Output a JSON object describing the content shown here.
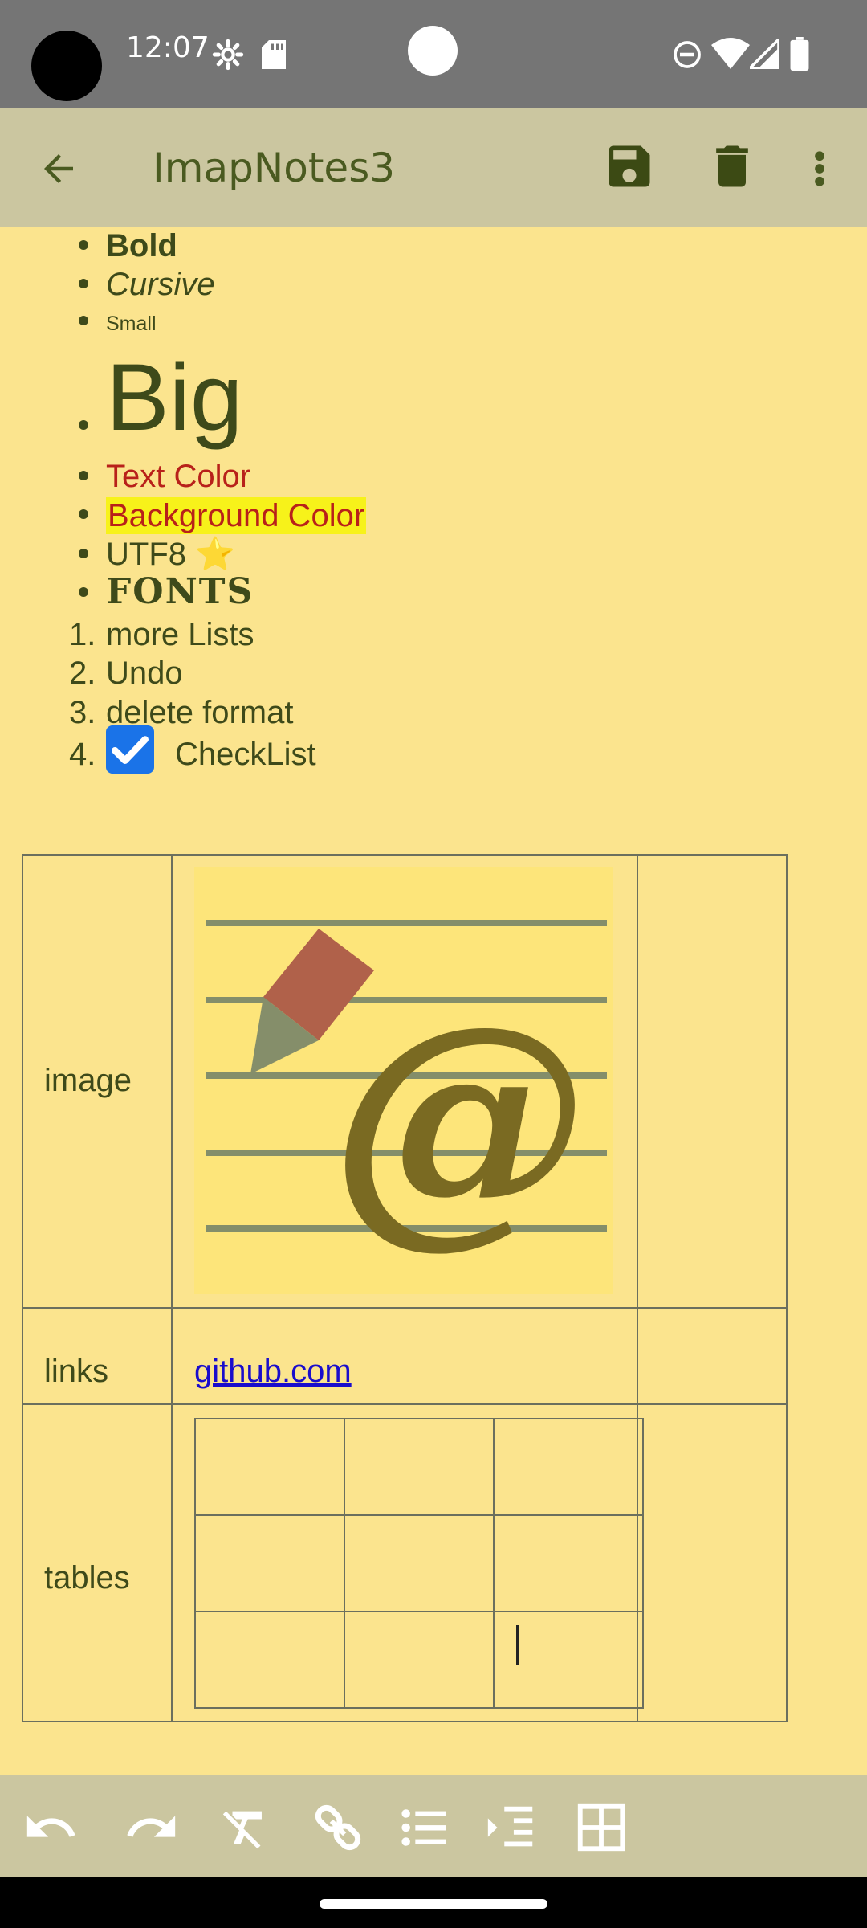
{
  "status_bar": {
    "time": "12:07",
    "icons": [
      "settings-icon",
      "sd-card-icon",
      "dnd-icon",
      "wifi-icon",
      "signal-icon",
      "battery-icon"
    ]
  },
  "app_bar": {
    "title": "ImapNotes3",
    "back": "back-arrow-icon",
    "save": "save-icon",
    "delete": "delete-icon",
    "more": "more-vert-icon"
  },
  "note": {
    "bullets": [
      {
        "label": "Bold"
      },
      {
        "label": "Cursive"
      },
      {
        "label": "Small"
      },
      {
        "label": "Big"
      },
      {
        "label": "Text Color"
      },
      {
        "label": "Background Color"
      },
      {
        "label": "UTF8 ⭐"
      },
      {
        "label": "FONTS"
      }
    ],
    "numbered": [
      {
        "num": "1.",
        "label": "more Lists"
      },
      {
        "num": "2.",
        "label": "Undo"
      },
      {
        "num": "3.",
        "label": "delete format"
      },
      {
        "num": "4.",
        "label": "CheckList"
      }
    ],
    "table": {
      "rows": [
        {
          "label": "image"
        },
        {
          "label": "links",
          "link": "github.com"
        },
        {
          "label": "tables"
        }
      ]
    }
  },
  "colors": {
    "text_color": "#b8211a",
    "highlight": "#f7f21a",
    "app_bar_bg": "#cbc6a0",
    "accent_text": "#4a5a20"
  },
  "toolbar": {
    "items": [
      "undo-icon",
      "redo-icon",
      "clear-format-icon",
      "link-icon",
      "bullet-list-icon",
      "indent-icon",
      "table-icon"
    ]
  }
}
